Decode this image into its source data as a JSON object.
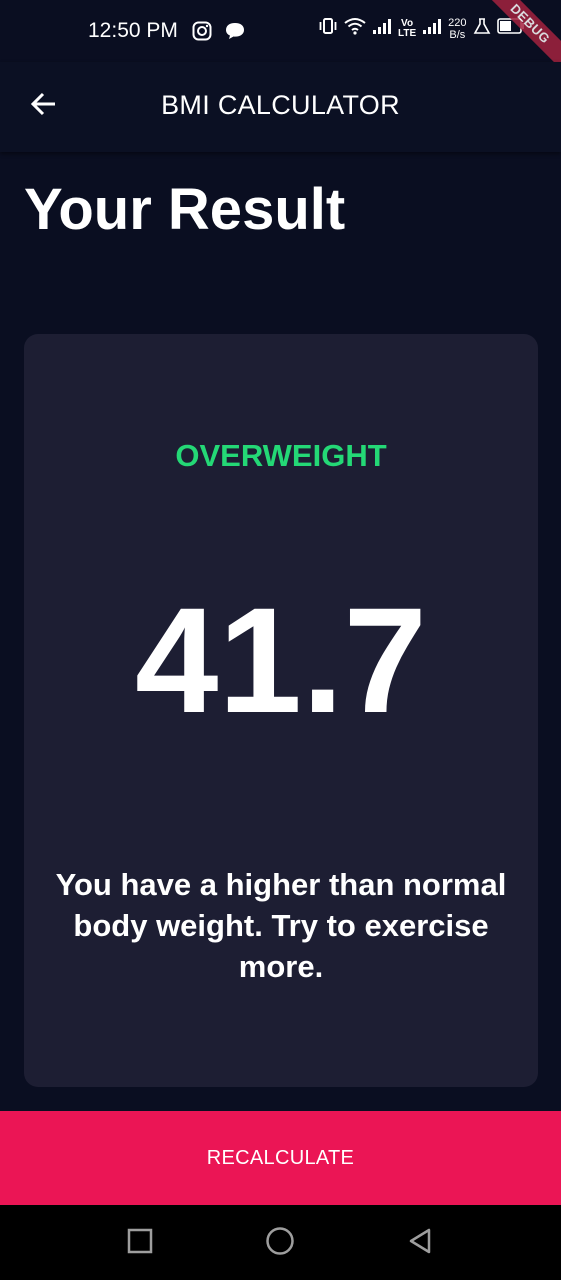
{
  "status_bar": {
    "time": "12:50 PM",
    "net_speed_value": "220",
    "net_speed_unit": "B/s",
    "volte_top": "Vo",
    "volte_bottom": "LTE",
    "debug_label": "DEBUG"
  },
  "app_bar": {
    "title": "BMI CALCULATOR"
  },
  "page": {
    "title": "Your Result"
  },
  "result": {
    "label": "OVERWEIGHT",
    "bmi": "41.7",
    "interpretation": "You have a higher than normal body weight. Try to exercise more."
  },
  "bottom_button": {
    "label": "RECALCULATE"
  },
  "colors": {
    "background": "#0a0e21",
    "card": "#1d1e33",
    "result_label": "#24d876",
    "accent": "#eb1555"
  },
  "icons": {
    "back": "arrow-left-icon",
    "nav_recents": "square-icon",
    "nav_home": "circle-icon",
    "nav_back": "triangle-back-icon"
  }
}
